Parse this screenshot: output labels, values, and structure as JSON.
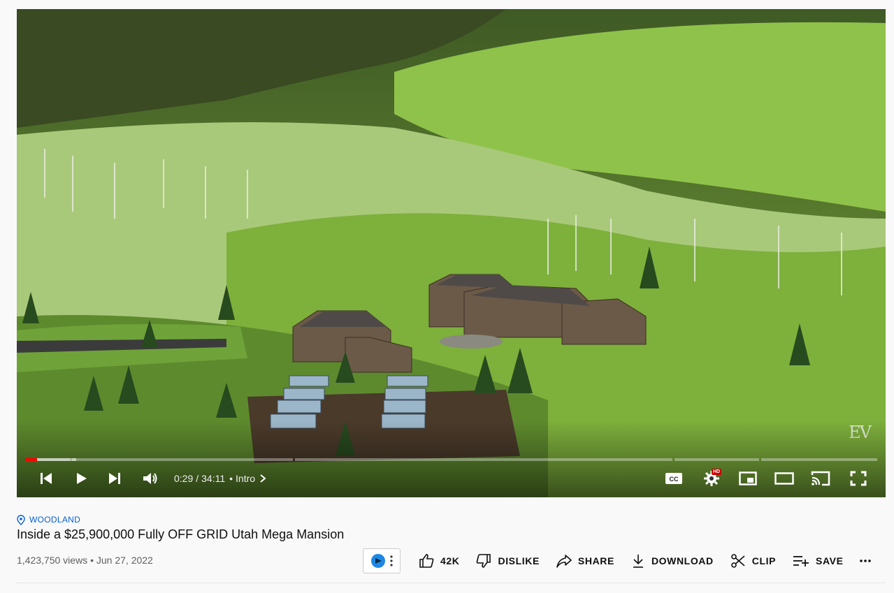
{
  "player": {
    "watermark": "EV",
    "progress": {
      "played_fraction": 0.014,
      "buffered_fraction": 0.06
    },
    "time": {
      "current": "0:29",
      "duration": "34:11",
      "separator": "/"
    },
    "chapter": {
      "bullet": "•",
      "label": "Intro"
    },
    "hd_badge": "HD",
    "icons": [
      "previous-icon",
      "play-icon",
      "next-icon",
      "volume-icon",
      "chevron-right-icon",
      "captions-icon",
      "settings-icon",
      "miniplayer-icon",
      "theater-icon",
      "cast-icon",
      "fullscreen-icon"
    ]
  },
  "video": {
    "location": "WOODLAND",
    "title": "Inside a $25,900,000 Fully OFF GRID Utah Mega Mansion",
    "views": "1,423,750 views",
    "date_separator": "•",
    "date": "Jun 27, 2022"
  },
  "actions": {
    "like_count": "42K",
    "dislike": "DISLIKE",
    "share": "SHARE",
    "download": "DOWNLOAD",
    "clip": "CLIP",
    "save": "SAVE"
  },
  "colors": {
    "accent": "#065fd4",
    "progress": "#ff0000",
    "text": "#0f0f0f",
    "muted": "#606060"
  }
}
